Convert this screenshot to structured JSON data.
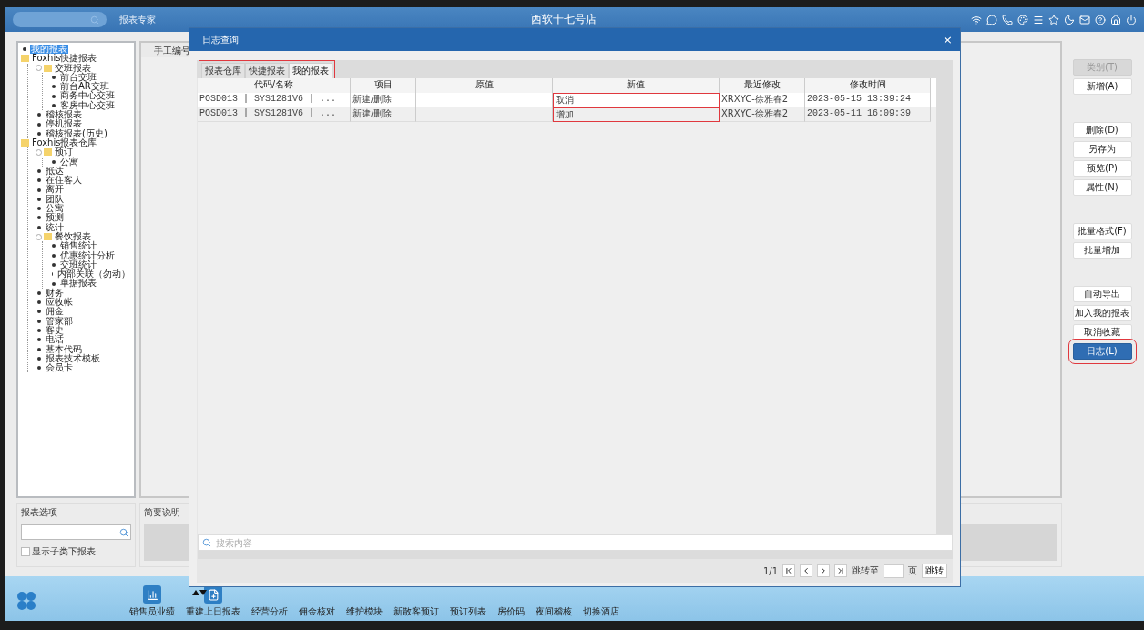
{
  "header": {
    "app_name": "报表专家",
    "title": "西软十七号店"
  },
  "tree": [
    {
      "label": "我的报表",
      "kind": "leaf",
      "selected": true
    },
    {
      "label": "Foxhis快捷报表",
      "kind": "folder",
      "selected": false,
      "expanded": true,
      "children": [
        {
          "label": "交班报表",
          "kind": "folder",
          "selected": false,
          "expanded": true,
          "children": [
            {
              "label": "前台交班",
              "kind": "leaf",
              "selected": false
            },
            {
              "label": "前台AR交班",
              "kind": "leaf",
              "selected": false
            },
            {
              "label": "商务中心交班",
              "kind": "leaf",
              "selected": false
            },
            {
              "label": "客房中心交班",
              "kind": "leaf",
              "selected": false
            }
          ]
        },
        {
          "label": "稽核报表",
          "kind": "leaf",
          "selected": false
        },
        {
          "label": "停机报表",
          "kind": "leaf",
          "selected": false
        },
        {
          "label": "稽核报表(历史)",
          "kind": "leaf",
          "selected": false
        }
      ]
    },
    {
      "label": "Foxhis报表仓库",
      "kind": "folder",
      "selected": false,
      "expanded": true,
      "children": [
        {
          "label": "预订",
          "kind": "folder",
          "selected": false,
          "expanded": true,
          "children": [
            {
              "label": "公寓",
              "kind": "leaf",
              "selected": false
            }
          ]
        },
        {
          "label": "抵达",
          "kind": "leaf",
          "selected": false
        },
        {
          "label": "在住客人",
          "kind": "leaf",
          "selected": false
        },
        {
          "label": "离开",
          "kind": "leaf",
          "selected": false
        },
        {
          "label": "团队",
          "kind": "leaf",
          "selected": false
        },
        {
          "label": "公寓",
          "kind": "leaf",
          "selected": false
        },
        {
          "label": "预测",
          "kind": "leaf",
          "selected": false
        },
        {
          "label": "统计",
          "kind": "leaf",
          "selected": false
        },
        {
          "label": "餐饮报表",
          "kind": "folder",
          "selected": false,
          "expanded": true,
          "children": [
            {
              "label": "销售统计",
              "kind": "leaf",
              "selected": false
            },
            {
              "label": "优惠统计分析",
              "kind": "leaf",
              "selected": false
            },
            {
              "label": "交班统计",
              "kind": "leaf",
              "selected": false
            },
            {
              "label": "内部关联（勿动）",
              "kind": "leaf",
              "selected": false
            },
            {
              "label": "单据报表",
              "kind": "leaf",
              "selected": false
            }
          ]
        },
        {
          "label": "财务",
          "kind": "leaf",
          "selected": false
        },
        {
          "label": "应收帐",
          "kind": "leaf",
          "selected": false
        },
        {
          "label": "佣金",
          "kind": "leaf",
          "selected": false
        },
        {
          "label": "管家部",
          "kind": "leaf",
          "selected": false
        },
        {
          "label": "客史",
          "kind": "leaf",
          "selected": false
        },
        {
          "label": "电话",
          "kind": "leaf",
          "selected": false
        },
        {
          "label": "基本代码",
          "kind": "leaf",
          "selected": false
        },
        {
          "label": "报表技术模板",
          "kind": "leaf",
          "selected": false
        },
        {
          "label": "会员卡",
          "kind": "leaf",
          "selected": false
        }
      ]
    }
  ],
  "report_list": {
    "columns": [
      "手工编号"
    ]
  },
  "report_options": {
    "title": "报表选项",
    "show_subclass": {
      "label": "显示子类下报表",
      "checked": false
    }
  },
  "summary": {
    "title": "简要说明"
  },
  "right_buttons": [
    [
      {
        "label": "类别(T)",
        "disabled": true,
        "primary": false,
        "highlighted": false
      },
      {
        "label": "新增(A)",
        "disabled": false,
        "primary": false,
        "highlighted": false
      }
    ],
    [
      {
        "label": "删除(D)",
        "disabled": false,
        "primary": false,
        "highlighted": false
      },
      {
        "label": "另存为",
        "disabled": false,
        "primary": false,
        "highlighted": false
      },
      {
        "label": "预览(P)",
        "disabled": false,
        "primary": false,
        "highlighted": false
      },
      {
        "label": "属性(N)",
        "disabled": false,
        "primary": false,
        "highlighted": false
      }
    ],
    [
      {
        "label": "批量格式(F)",
        "disabled": false,
        "primary": false,
        "highlighted": false
      },
      {
        "label": "批量增加",
        "disabled": false,
        "primary": false,
        "highlighted": false
      }
    ],
    [
      {
        "label": "自动导出",
        "disabled": false,
        "primary": false,
        "highlighted": false
      },
      {
        "label": "加入我的报表",
        "disabled": false,
        "primary": false,
        "highlighted": false
      },
      {
        "label": "取消收藏",
        "disabled": false,
        "primary": false,
        "highlighted": false
      },
      {
        "label": "日志(L)",
        "disabled": false,
        "primary": true,
        "highlighted": true
      }
    ]
  ],
  "dialog": {
    "title": "日志查询",
    "close": "×",
    "tabs_highlighted": true,
    "tabs": [
      {
        "label": "报表仓库",
        "selected": false
      },
      {
        "label": "快捷报表",
        "selected": false
      },
      {
        "label": "我的报表",
        "selected": true
      }
    ],
    "table": {
      "columns": [
        {
          "label": "代码/名称",
          "highlighted": false
        },
        {
          "label": "项目",
          "highlighted": false
        },
        {
          "label": "原值",
          "highlighted": false
        },
        {
          "label": "新值",
          "highlighted": true
        },
        {
          "label": "最近修改",
          "highlighted": false
        },
        {
          "label": "修改时间",
          "highlighted": false
        }
      ],
      "rows": [
        {
          "cells": [
            "POSD013 | SYS1281V6 | ...",
            "新建/删除",
            "",
            "取消",
            "XRXYC-徐雅春2",
            "2023-05-15 13:39:24"
          ]
        },
        {
          "cells": [
            "POSD013 | SYS1281V6 | ...",
            "新建/删除",
            "",
            "增加",
            "XRXYC-徐雅春2",
            "2023-05-11 16:09:39"
          ]
        }
      ]
    },
    "search": {
      "placeholder": "搜索内容"
    },
    "pager": {
      "page": "1/1",
      "goto_label": "跳转至",
      "page_unit": "页",
      "goto_button": "跳转"
    }
  },
  "taskbar": [
    {
      "label": "销售员业绩",
      "kind": "chart"
    },
    {
      "label": "重建上日报表",
      "kind": "file"
    },
    {
      "label": "经营分析",
      "kind": "text"
    },
    {
      "label": "佣金核对",
      "kind": "text"
    },
    {
      "label": "维护模块",
      "kind": "text"
    },
    {
      "label": "新散客预订",
      "kind": "text"
    },
    {
      "label": "预订列表",
      "kind": "text"
    },
    {
      "label": "房价码",
      "kind": "text"
    },
    {
      "label": "夜间稽核",
      "kind": "text"
    },
    {
      "label": "切换酒店",
      "kind": "text"
    }
  ]
}
